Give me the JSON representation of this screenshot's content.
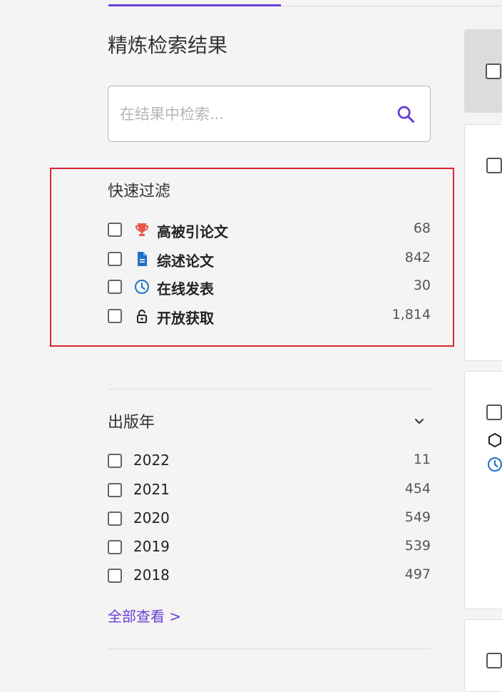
{
  "refine": {
    "title": "精炼检索结果",
    "search_placeholder": "在结果中检索..."
  },
  "quick_filter": {
    "title": "快速过滤",
    "items": [
      {
        "label": "高被引论文",
        "count": "68",
        "icon": "trophy-icon",
        "icon_color": "#e8594a"
      },
      {
        "label": "综述论文",
        "count": "842",
        "icon": "document-icon",
        "icon_color": "#1f6fc5"
      },
      {
        "label": "在线发表",
        "count": "30",
        "icon": "clock-icon",
        "icon_color": "#1f6fc5"
      },
      {
        "label": "开放获取",
        "count": "1,814",
        "icon": "lock-icon",
        "icon_color": "#222222"
      }
    ]
  },
  "pub_year": {
    "title": "出版年",
    "items": [
      {
        "label": "2022",
        "count": "11"
      },
      {
        "label": "2021",
        "count": "454"
      },
      {
        "label": "2020",
        "count": "549"
      },
      {
        "label": "2019",
        "count": "539"
      },
      {
        "label": "2018",
        "count": "497"
      }
    ],
    "view_all": "全部查看 >"
  },
  "colors": {
    "accent": "#6a3fd2",
    "highlight_border": "#d9262e"
  }
}
